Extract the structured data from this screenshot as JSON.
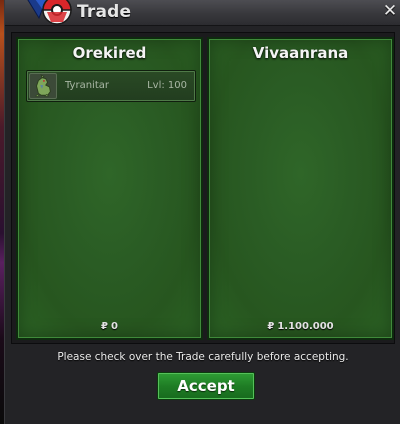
{
  "window": {
    "title": "Trade",
    "close_glyph": "✕"
  },
  "icons": {
    "logo": "pokeball-icon",
    "close": "close-icon",
    "currency": "pokedollar-icon",
    "pokemon": "tyranitar-sprite-icon"
  },
  "colors": {
    "panel_green": "#2a5c24",
    "accept_green": "#1f7d25",
    "window_bg": "#232326"
  },
  "traders": [
    {
      "name": "Orekired",
      "items": [
        {
          "pokemon": "Tyranitar",
          "level": "Lvl: 100"
        }
      ],
      "currency_symbol": "₽",
      "money": "0"
    },
    {
      "name": "Vivaanrana",
      "items": [],
      "currency_symbol": "₽",
      "money": "1.100.000"
    }
  ],
  "notice": "Please check over the Trade carefully before accepting.",
  "accept_label": "Accept"
}
